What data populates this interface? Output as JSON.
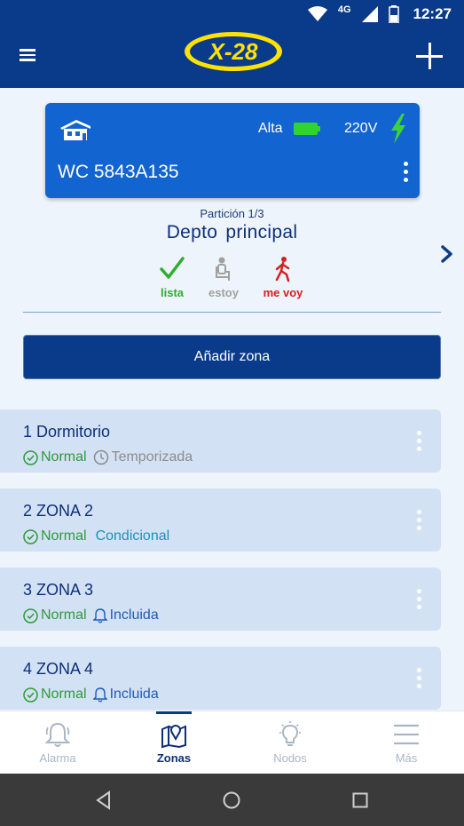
{
  "status_bar": {
    "network": "4G",
    "time": "12:27"
  },
  "app_bar": {
    "logo_text": "X-28"
  },
  "device": {
    "battery_label": "Alta",
    "voltage": "220V",
    "name": "WC 5843A135"
  },
  "partition": {
    "index": "Partición 1/3",
    "name": "Depto  principal",
    "modes": [
      {
        "label": "lista",
        "color": "#2eae2e"
      },
      {
        "label": "estoy",
        "color": "#a0a0a0"
      },
      {
        "label": "me voy",
        "color": "#d42020"
      }
    ]
  },
  "add_zone_label": "Añadir zona",
  "zones": [
    {
      "title": "1 Dormitorio",
      "status": "Normal",
      "tag": "Temporizada",
      "tag_icon": "clock-icon"
    },
    {
      "title": "2 ZONA 2",
      "status": "Normal",
      "tag": "Condicional",
      "tag_icon": ""
    },
    {
      "title": "3 ZONA 3",
      "status": "Normal",
      "tag": "Incluida",
      "tag_icon": "bell-icon"
    },
    {
      "title": "4 ZONA 4",
      "status": "Normal",
      "tag": "Incluida",
      "tag_icon": "bell-icon"
    }
  ],
  "bottom_nav": [
    {
      "label": "Alarma",
      "icon": "bell-icon",
      "active": false
    },
    {
      "label": "Zonas",
      "icon": "map-pin-icon",
      "active": true
    },
    {
      "label": "Nodos",
      "icon": "lightbulb-icon",
      "active": false
    },
    {
      "label": "Más",
      "icon": "menu-icon",
      "active": false
    }
  ],
  "colors": {
    "app_bar": "#0a3a8a",
    "card": "#1264d0",
    "battery": "#2fd42f",
    "bolt": "#3ad43a",
    "zone_bg": "#d3e1f4",
    "normal": "#2e9a3a"
  }
}
